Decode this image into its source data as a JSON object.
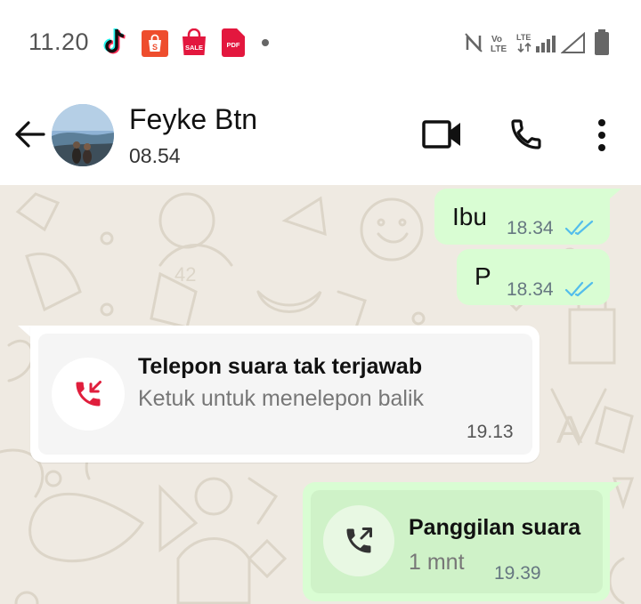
{
  "status_bar": {
    "time": "11.20",
    "notification_icons": [
      "tiktok-icon",
      "shopee-icon",
      "sale-bag-icon",
      "pdf-icon"
    ],
    "sale_label": "SALE",
    "pdf_label": "PDF",
    "system_icons": [
      "nfc-icon",
      "volte-icon",
      "lte-signal-icon",
      "signal-icon",
      "battery-icon"
    ],
    "volte_label": "Vo LTE",
    "lte_label": "LTE"
  },
  "header": {
    "contact_name": "Feyke Btn",
    "subtitle": "08.54",
    "actions": [
      "video-call-icon",
      "voice-call-icon",
      "more-options-icon"
    ]
  },
  "messages": [
    {
      "text": "Ibu",
      "time": "18.34",
      "status": "read"
    },
    {
      "text": "P",
      "time": "18.34",
      "status": "read"
    }
  ],
  "missed_call": {
    "title": "Telepon suara tak terjawab",
    "subtitle": "Ketuk untuk menelepon balik",
    "time": "19.13"
  },
  "voice_call": {
    "title": "Panggilan suara",
    "duration": "1 mnt",
    "time": "19.39"
  },
  "colors": {
    "chat_background": "#efeae2",
    "outgoing_bubble": "#d9fdd3",
    "incoming_bubble": "#ffffff",
    "read_ticks": "#53bdeb",
    "missed_call_red": "#e01e3c"
  }
}
